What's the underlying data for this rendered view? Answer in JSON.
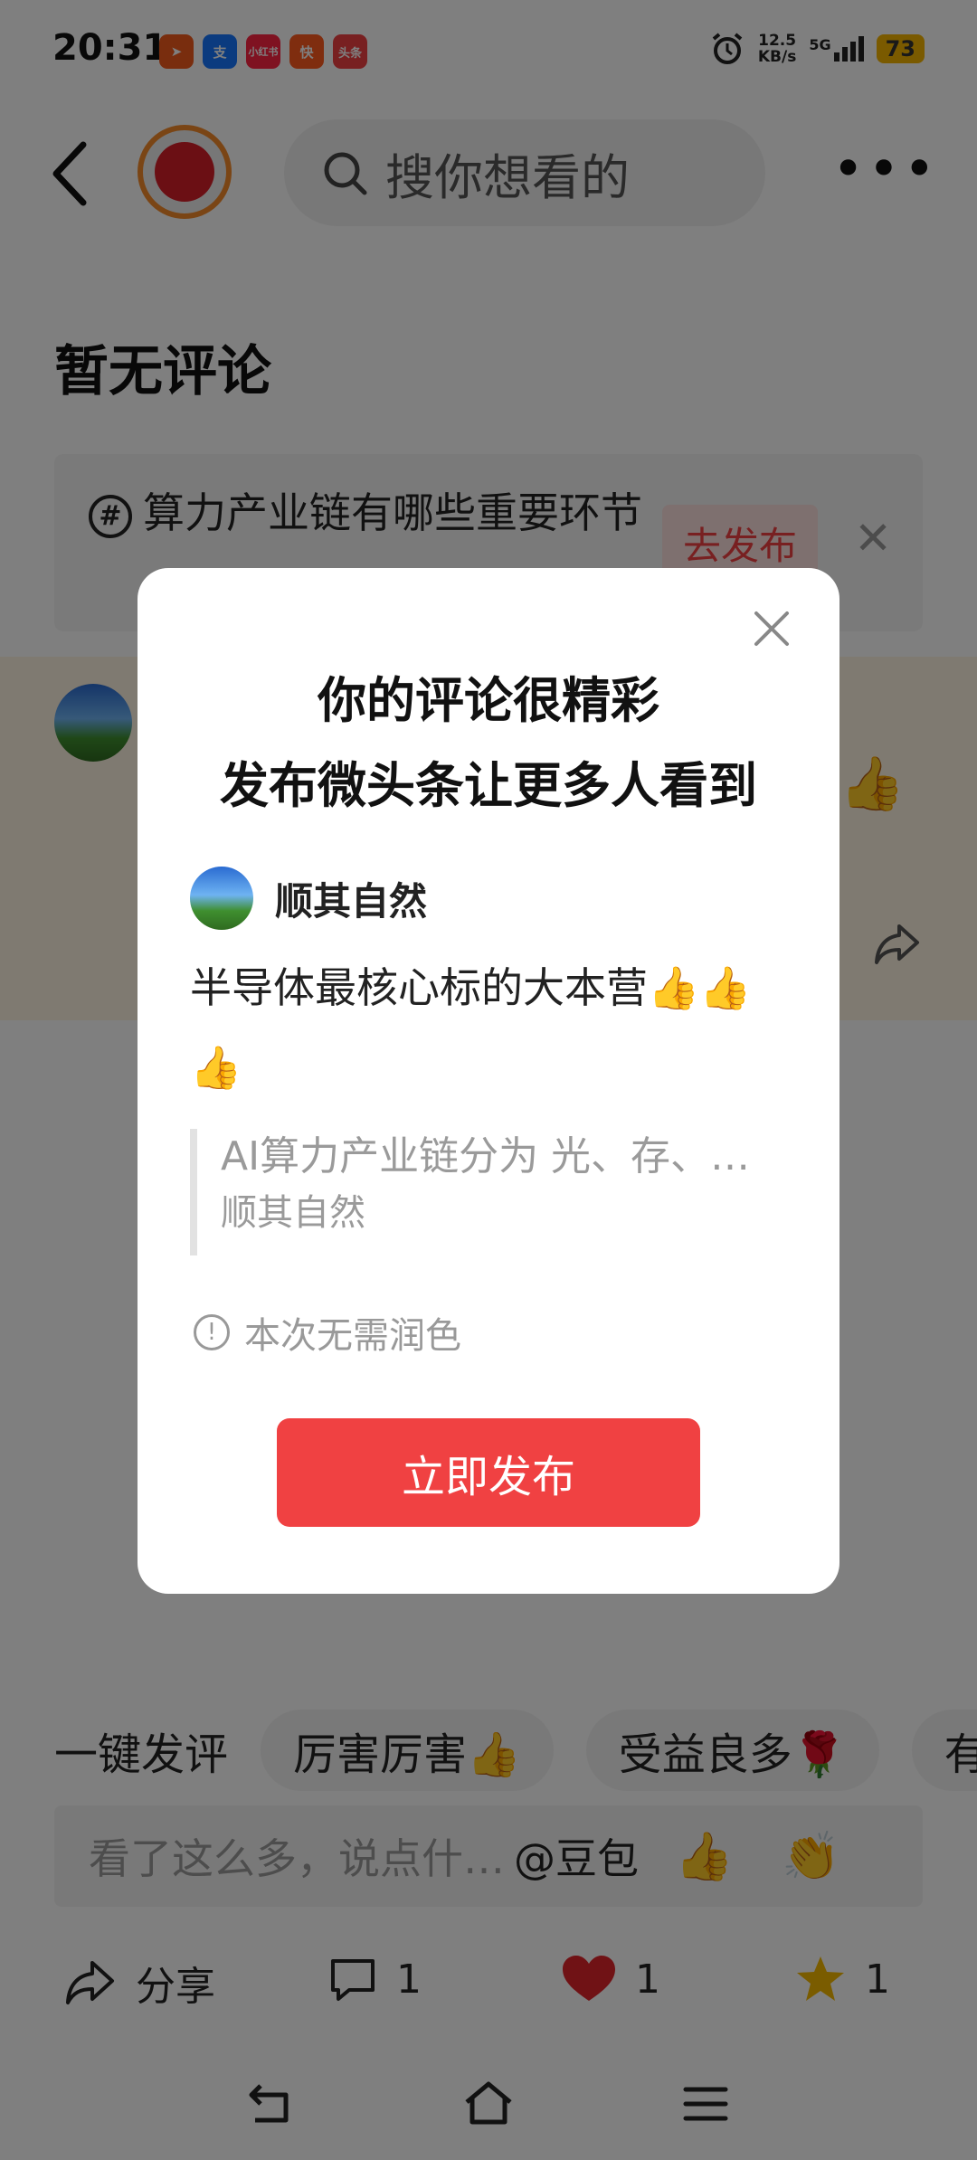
{
  "status_bar": {
    "time": "20:31",
    "apps": [
      {
        "icon": "paper-plane-app-icon",
        "label": "➤",
        "color": "#f25a1d"
      },
      {
        "icon": "alipay-app-icon",
        "label": "支",
        "color": "#1677ff"
      },
      {
        "icon": "xiaohongshu-app-icon",
        "label": "小红书",
        "color": "#ff2442"
      },
      {
        "icon": "kuaishou-app-icon",
        "label": "快",
        "color": "#ff5a1f"
      },
      {
        "icon": "toutiao-app-icon",
        "label": "头条",
        "color": "#f04142"
      }
    ],
    "speed_value": "12.5",
    "speed_unit": "KB/s",
    "network": "5G",
    "battery": "73"
  },
  "top_nav": {
    "search_placeholder": "搜你想看的",
    "more": "•••"
  },
  "no_comment_title": "暂无评论",
  "topic": {
    "hash_symbol": "#",
    "text": "算力产业链有哪些重要环节",
    "publish_label": "去发布",
    "close": "✕"
  },
  "comment_row": {
    "thumb": "👍"
  },
  "modal": {
    "title_line1": "你的评论很精彩",
    "title_line2": "发布微头条让更多人看到",
    "user_name": "顺其自然",
    "comment_text": "半导体最核心标的大本营👍👍👍",
    "quote_text": "AI算力产业链分为 光、存、…",
    "quote_author": "顺其自然",
    "tip_icon": "!",
    "tip_text": "本次无需润色",
    "publish_button": "立即发布"
  },
  "quick_comments": {
    "label": "一键发评",
    "chips": [
      "厉害厉害👍",
      "受益良多🌹",
      "有点"
    ]
  },
  "input": {
    "placeholder": "看了这么多，说点什…",
    "at_label": "@豆包",
    "emoji1": "👍",
    "emoji2": "👏"
  },
  "actions": {
    "share_label": "分享",
    "comment_count": "1",
    "like_count": "1",
    "favorite_count": "1"
  },
  "colors": {
    "accent_red": "#f04142",
    "like_red": "#e0242a",
    "star_yellow": "#f5b800"
  }
}
